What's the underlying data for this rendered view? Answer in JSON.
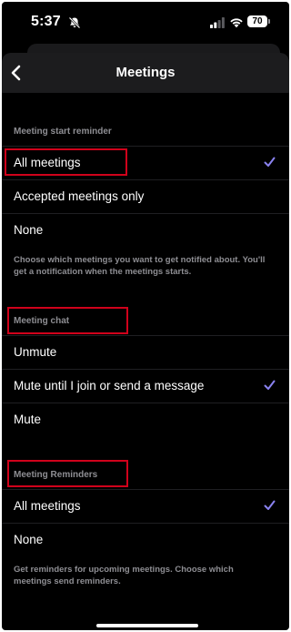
{
  "status_bar": {
    "time": "5:37",
    "battery": "70",
    "icons": [
      "bell-muted-icon",
      "signal-icon",
      "wifi-icon",
      "battery-icon"
    ]
  },
  "nav": {
    "title": "Meetings",
    "back_icon": "chevron-left-icon"
  },
  "sections": {
    "start_reminder": {
      "header": "Meeting start reminder",
      "options": [
        {
          "label": "All meetings",
          "checked": true
        },
        {
          "label": "Accepted meetings only",
          "checked": false
        },
        {
          "label": "None",
          "checked": false
        }
      ],
      "footer": "Choose which meetings you want to get notified about. You'll get a notification when the meetings starts."
    },
    "chat": {
      "header": "Meeting chat",
      "options": [
        {
          "label": "Unmute",
          "checked": false
        },
        {
          "label": "Mute until I join or send a message",
          "checked": true
        },
        {
          "label": "Mute",
          "checked": false
        }
      ]
    },
    "reminders": {
      "header": "Meeting Reminders",
      "options": [
        {
          "label": "All meetings",
          "checked": true
        },
        {
          "label": "None",
          "checked": false
        }
      ],
      "footer": "Get reminders for upcoming meetings. Choose which meetings send reminders."
    }
  },
  "colors": {
    "background": "#000000",
    "checkmark": "#8a82f0",
    "annotation": "#d0021b",
    "secondary_text": "#8e8e93"
  }
}
